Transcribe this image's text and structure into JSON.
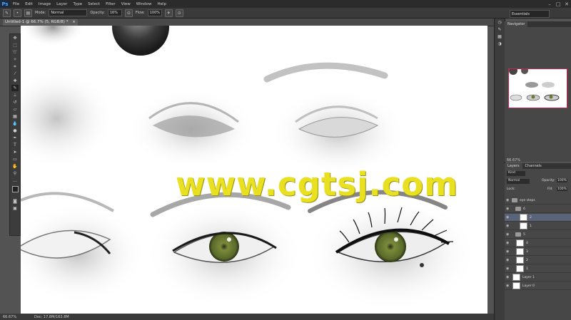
{
  "app": {
    "logo": "Ps"
  },
  "menubar": {
    "items": [
      "File",
      "Edit",
      "Image",
      "Layer",
      "Type",
      "Select",
      "Filter",
      "View",
      "Window",
      "Help"
    ]
  },
  "window_controls": {
    "minimize": "–",
    "maximize": "□",
    "close": "✕"
  },
  "options": {
    "mode_label": "Mode:",
    "mode_value": "Normal",
    "opacity_label": "Opacity:",
    "opacity_value": "16%",
    "flow_label": "Flow:",
    "flow_value": "100%",
    "workspace": "Essentials"
  },
  "document": {
    "tab_title": "Untitled-1 @ 66.7% (5, RGB/8) *",
    "close": "×"
  },
  "watermark": "www.cgtsj.com",
  "statusbar": {
    "zoom": "66.67%",
    "doc_size": "Doc: 17.8M/163.8M"
  },
  "navigator": {
    "tab": "Navigator",
    "zoom": "66.67%"
  },
  "layers_panel": {
    "tabs": [
      "Layers",
      "Channels"
    ],
    "kind_label": "Kind",
    "blend_mode": "Normal",
    "opacity_label": "Opacity:",
    "opacity_value": "100%",
    "lock_label": "Lock:",
    "fill_label": "Fill:",
    "fill_value": "100%",
    "layers": [
      {
        "name": "eye steps",
        "type": "group",
        "selected": false,
        "indent": 0
      },
      {
        "name": "6",
        "type": "group",
        "selected": false,
        "indent": 1
      },
      {
        "name": "2",
        "type": "layer",
        "selected": true,
        "indent": 2
      },
      {
        "name": "1",
        "type": "layer",
        "selected": false,
        "indent": 2
      },
      {
        "name": "5",
        "type": "group",
        "selected": false,
        "indent": 1
      },
      {
        "name": "4",
        "type": "layer",
        "selected": false,
        "indent": 1
      },
      {
        "name": "3",
        "type": "layer",
        "selected": false,
        "indent": 1
      },
      {
        "name": "2",
        "type": "layer",
        "selected": false,
        "indent": 1
      },
      {
        "name": "1",
        "type": "layer",
        "selected": false,
        "indent": 1
      },
      {
        "name": "Layer 1",
        "type": "layer",
        "selected": false,
        "indent": 0
      },
      {
        "name": "Layer 0",
        "type": "layer",
        "selected": false,
        "indent": 0
      }
    ]
  },
  "colors": {
    "accent": "#4ca2ff",
    "watermark": "#e8e020",
    "iris": "#7a8a3a",
    "nav_frame": "#d02050"
  }
}
